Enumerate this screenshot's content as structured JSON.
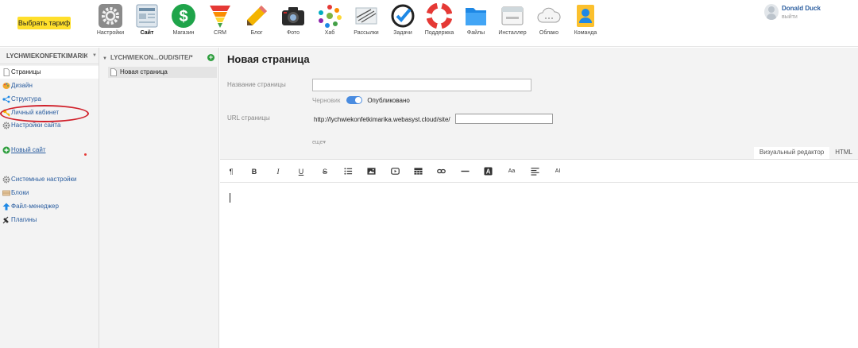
{
  "topbar": {
    "tariff_label": "Выбрать тариф",
    "apps": [
      {
        "label": "Настройки",
        "icon": "settings-gear-icon"
      },
      {
        "label": "Сайт",
        "icon": "site-icon"
      },
      {
        "label": "Магазин",
        "icon": "shop-dollar-icon"
      },
      {
        "label": "CRM",
        "icon": "crm-funnel-icon"
      },
      {
        "label": "Блог",
        "icon": "blog-pencil-icon"
      },
      {
        "label": "Фото",
        "icon": "photo-camera-icon"
      },
      {
        "label": "Хаб",
        "icon": "hub-icon"
      },
      {
        "label": "Рассылки",
        "icon": "mailer-icon"
      },
      {
        "label": "Задачи",
        "icon": "tasks-check-icon"
      },
      {
        "label": "Поддержка",
        "icon": "support-lifebuoy-icon"
      },
      {
        "label": "Файлы",
        "icon": "files-folder-icon"
      },
      {
        "label": "Инсталлер",
        "icon": "installer-icon"
      },
      {
        "label": "Облако",
        "icon": "cloud-icon"
      },
      {
        "label": "Команда",
        "icon": "team-icon"
      }
    ],
    "active_app": "Сайт",
    "user_name": "Donald Duck",
    "logout_label": "выйти"
  },
  "sidebar": {
    "site_title": "LYCHWIEKONFETKIMARIKA.WEBASYST.CLOUD",
    "items": [
      {
        "label": "Страницы",
        "icon": "page-icon"
      },
      {
        "label": "Дизайн",
        "icon": "palette-icon"
      },
      {
        "label": "Структура",
        "icon": "structure-icon"
      },
      {
        "label": "Личный кабинет",
        "icon": "key-icon"
      },
      {
        "label": "Настройки сайта",
        "icon": "gear-icon"
      }
    ],
    "new_site_label": "Новый сайт",
    "tools": [
      {
        "label": "Системные настройки",
        "icon": "gear-icon"
      },
      {
        "label": "Блоки",
        "icon": "blocks-icon"
      },
      {
        "label": "Файл-менеджер",
        "icon": "upload-arrow-icon"
      },
      {
        "label": "Плагины",
        "icon": "plugin-icon"
      }
    ]
  },
  "pages_panel": {
    "title": "LYCHWIEKON...OUD/SITE/*",
    "pages": [
      {
        "label": "Новая страница"
      }
    ]
  },
  "editor": {
    "heading": "Новая страница",
    "name_label": "Название страницы",
    "name_value": "",
    "draft_label": "Черновик",
    "published_label": "Опубликовано",
    "url_label": "URL страницы",
    "url_prefix": "http://lychwiekonfetkimarika.webasyst.cloud/site/",
    "url_value": "",
    "more_label": "еще▾",
    "tabs": [
      "Визуальный редактор",
      "HTML"
    ],
    "toolbar_glyphs": [
      "¶",
      "B",
      "I",
      "U",
      "S",
      "Aa",
      "AI"
    ]
  },
  "colors": {
    "tariff_bg": "#ffdf2b",
    "link_blue": "#2a5d9f",
    "toggle_blue": "#4a8ce0",
    "highlight_red": "#d0202a",
    "panel_bg": "#f3f3f3"
  }
}
